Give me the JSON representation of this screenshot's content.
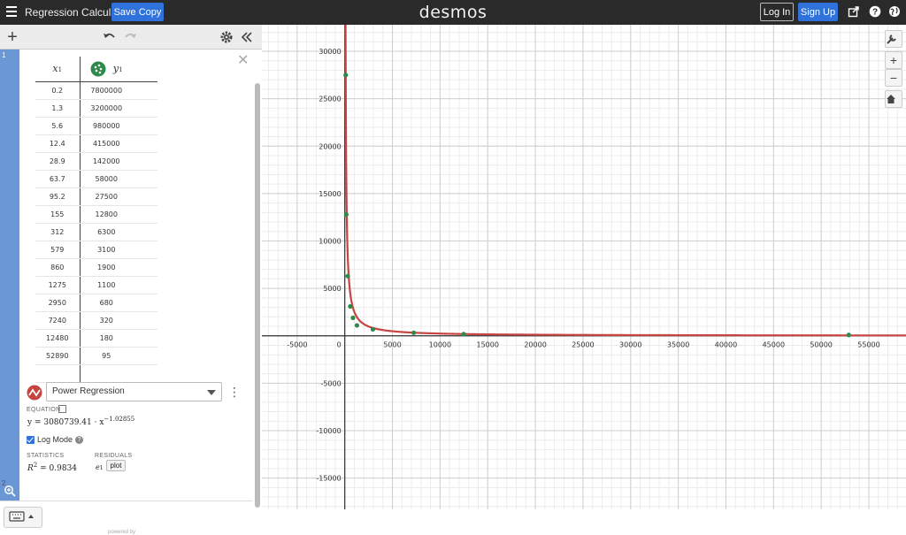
{
  "header": {
    "app_title": "Regression Calculator",
    "save_copy_label": "Save Copy",
    "brand": "desmos",
    "login_label": "Log In",
    "signup_label": "Sign Up",
    "bg_color": "#2a2a2a",
    "accent_color": "#2f72dc"
  },
  "expressions": {
    "item1_number": "1",
    "item2_number": "2",
    "table": {
      "x_header": "x",
      "x_sub": "1",
      "y_header": "y",
      "y_sub": "1",
      "rows": [
        [
          "0.2",
          "7800000"
        ],
        [
          "1.3",
          "3200000"
        ],
        [
          "5.6",
          "980000"
        ],
        [
          "12.4",
          "415000"
        ],
        [
          "28.9",
          "142000"
        ],
        [
          "63.7",
          "58000"
        ],
        [
          "95.2",
          "27500"
        ],
        [
          "155",
          "12800"
        ],
        [
          "312",
          "6300"
        ],
        [
          "579",
          "3100"
        ],
        [
          "860",
          "1900"
        ],
        [
          "1275",
          "1100"
        ],
        [
          "2950",
          "680"
        ],
        [
          "7240",
          "320"
        ],
        [
          "12480",
          "180"
        ],
        [
          "52890",
          "95"
        ]
      ]
    },
    "regression": {
      "type_label": "Power Regression",
      "equation_caption": "EQUATION",
      "equation": "y = 3080739.41 · x",
      "exponent": "−1.02855",
      "log_mode_label": "Log Mode",
      "statistics_caption": "STATISTICS",
      "residuals_caption": "RESIDUALS",
      "r2_value": "= 0.9834",
      "residual_var": "e",
      "residual_sub": "1",
      "plot_label": "plot",
      "curve_color": "#c74440",
      "point_color": "#2d8a4a"
    },
    "powered_by": "powered by"
  },
  "graph": {
    "x_ticks": [
      "-5000",
      "0",
      "5000",
      "10000",
      "15000",
      "20000",
      "25000",
      "30000",
      "35000",
      "40000",
      "45000",
      "50000",
      "55000"
    ],
    "y_ticks": [
      "30000",
      "25000",
      "20000",
      "15000",
      "10000",
      "5000",
      "-5000",
      "-10000",
      "-15000"
    ]
  },
  "chart_data": {
    "type": "scatter",
    "x": [
      0.2,
      1.3,
      5.6,
      12.4,
      28.9,
      63.7,
      95.2,
      155,
      312,
      579,
      860,
      1275,
      2950,
      7240,
      12480,
      52890
    ],
    "y": [
      7800000,
      3200000,
      980000,
      415000,
      142000,
      58000,
      27500,
      12800,
      6300,
      3100,
      1900,
      1100,
      680,
      320,
      180,
      95
    ],
    "fit": {
      "model": "power",
      "a": 3080739.41,
      "b": -1.02855,
      "r2": 0.9834
    },
    "xlim": [
      -8700,
      58900
    ],
    "ylim": [
      -18300,
      32800
    ],
    "grid": true
  }
}
